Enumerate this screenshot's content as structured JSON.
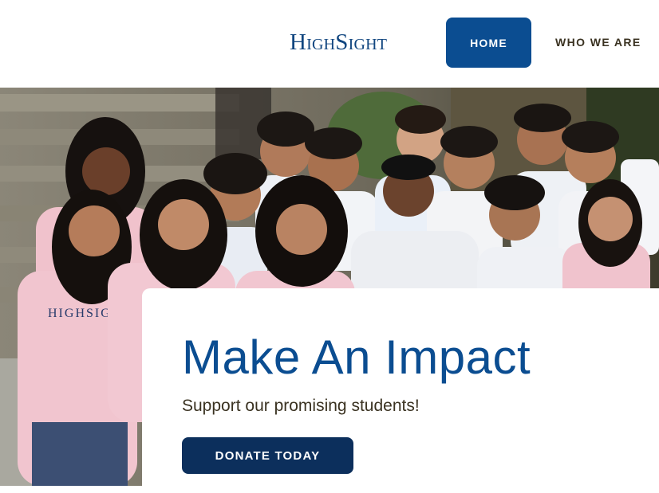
{
  "header": {
    "logo_text": "HighSight",
    "nav": {
      "home_label": "HOME",
      "who_label": "WHO WE ARE"
    }
  },
  "hero": {
    "shirt_text": "HIGHSIGHT"
  },
  "callout": {
    "title": "Make An Impact",
    "subtitle": "Support our promising students!",
    "button_label": "DONATE TODAY"
  },
  "colors": {
    "brand_blue": "#0b4d91",
    "dark_navy": "#0c2f5c",
    "text_brown": "#3a3221",
    "background": "#ffffff"
  }
}
